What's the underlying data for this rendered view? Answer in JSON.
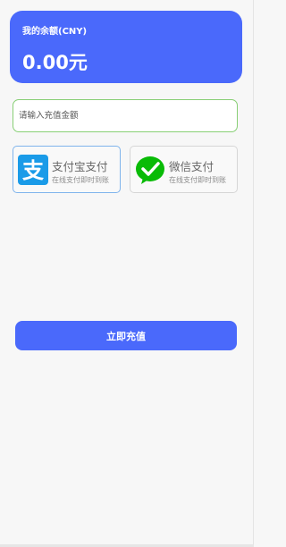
{
  "balance": {
    "label": "我的余额(CNY)",
    "value": "0.00元"
  },
  "recharge": {
    "amount_placeholder": "请输入充值金额",
    "amount_value": ""
  },
  "payment_methods": [
    {
      "name": "支付宝支付",
      "subtitle": "在线支付即时到账",
      "icon": "alipay-icon",
      "selected": true,
      "color": "#1a9be8"
    },
    {
      "name": "微信支付",
      "subtitle": "在线支付即时到账",
      "icon": "wechat-pay-icon",
      "selected": false,
      "color": "#09bb07"
    }
  ],
  "submit": {
    "label": "立即充值"
  },
  "colors": {
    "accent": "#4a69fb",
    "input_border": "#88cf75",
    "selected_border": "#7fb4ec",
    "background": "#f7f7f7"
  }
}
